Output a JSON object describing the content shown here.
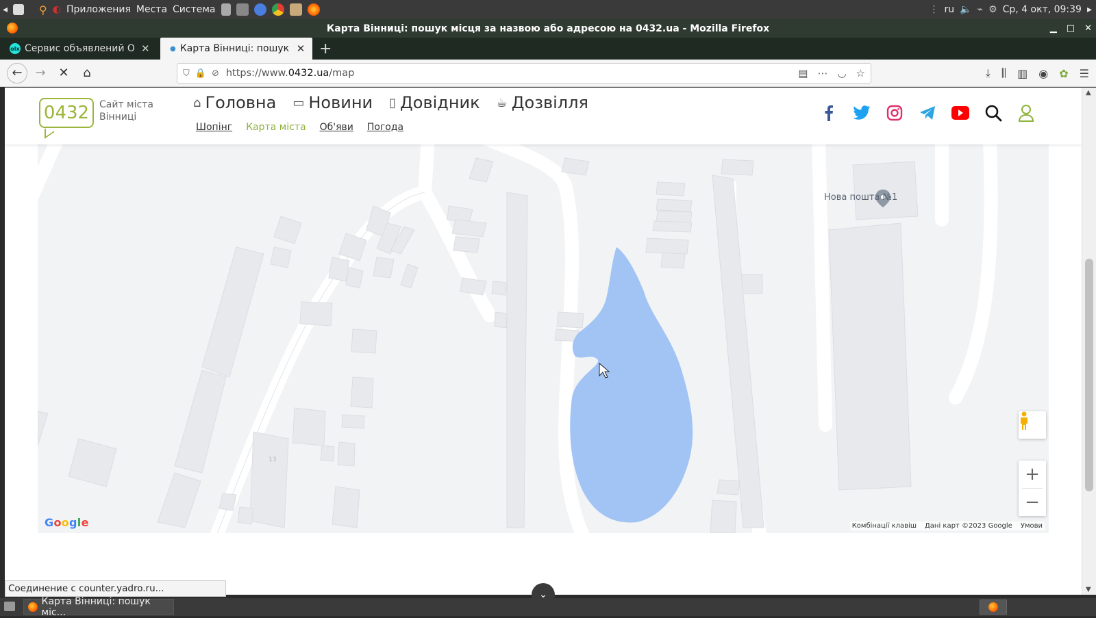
{
  "system_panel": {
    "menu_apps": "Приложения",
    "menu_places": "Места",
    "menu_system": "Система",
    "lang": "ru",
    "datetime": "Ср, 4 окт, 09:39"
  },
  "window": {
    "title": "Карта Вінниці: пошук місця за назвою або адресою на 0432.ua - Mozilla Firefox",
    "minimize": "▁",
    "maximize": "□",
    "close": "✕"
  },
  "tabs": [
    {
      "label": "Сервис объявлений OLX",
      "close": "✕",
      "active": false
    },
    {
      "label": "Карта Вінниці: пошук місця",
      "close": "✕",
      "active": true
    }
  ],
  "new_tab": "+",
  "address_bar": {
    "url_prefix": "https://www.",
    "url_domain": "0432.ua",
    "url_path": "/map"
  },
  "site": {
    "logo_text": "0432",
    "logo_sub_1": "Сайт міста",
    "logo_sub_2": "Вінниці",
    "menu": [
      {
        "label": "Головна",
        "icon": "home-icon"
      },
      {
        "label": "Новини",
        "icon": "chat-icon"
      },
      {
        "label": "Довідник",
        "icon": "notebook-icon"
      },
      {
        "label": "Дозвілля",
        "icon": "coffee-icon"
      }
    ],
    "submenu": [
      {
        "label": "Шопінг",
        "active": false
      },
      {
        "label": "Карта міста",
        "active": true
      },
      {
        "label": "Об'яви",
        "active": false
      },
      {
        "label": "Погода",
        "active": false
      }
    ],
    "social_colors": {
      "facebook": "#3b5998",
      "twitter": "#1da1f2",
      "instagram": "#e1306c",
      "telegram": "#2ca5e0",
      "youtube": "#ff0000",
      "user": "#8db13a"
    }
  },
  "map": {
    "poi_label": "Нова пошта №1",
    "building_number": "13",
    "google_logo": "Google",
    "footer_shortcuts": "Комбінації клавіш",
    "footer_data": "Дані карт ©2023 Google",
    "footer_terms": "Умови",
    "zoom_in": "+",
    "zoom_out": "−",
    "water_color": "#a1c4f5"
  },
  "status_bar": "Соединение с counter.yadro.ru...",
  "taskbar": {
    "task_label": "Карта Вінниці: пошук міс..."
  }
}
